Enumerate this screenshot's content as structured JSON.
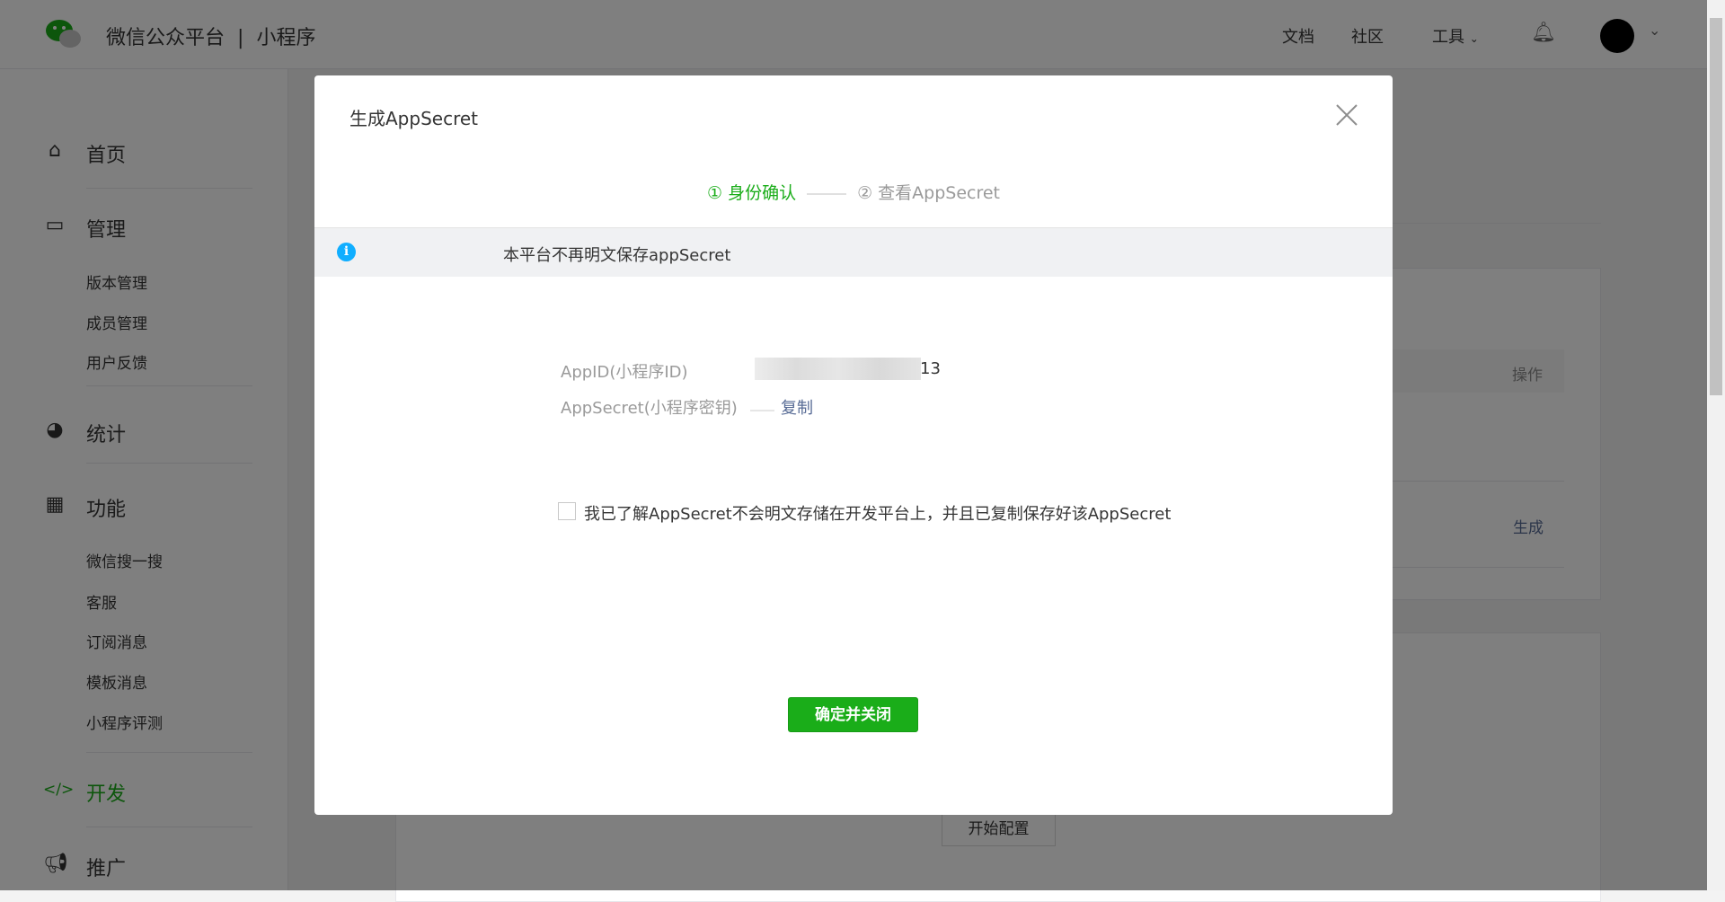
{
  "header": {
    "brand": "微信公众平台",
    "separator": "|",
    "product": "小程序",
    "nav": [
      "文档",
      "社区",
      "工具"
    ]
  },
  "sidebar": {
    "home": "首页",
    "manage": "管理",
    "manage_items": [
      "版本管理",
      "成员管理",
      "用户反馈"
    ],
    "stats": "统计",
    "features": "功能",
    "feature_items": [
      "微信搜一搜",
      "客服",
      "订阅消息",
      "模板消息",
      "小程序评测"
    ],
    "develop": "开发",
    "promote": "推广"
  },
  "background": {
    "col_action": "操作",
    "generate": "生成",
    "start_config": "开始配置"
  },
  "modal": {
    "title": "生成AppSecret",
    "step1": "① 身份确认",
    "step2": "② 查看AppSecret",
    "info": "本平台不再明文保存appSecret",
    "appid_label": "AppID(小程序ID)",
    "appid_value_suffix": "13",
    "secret_label": "AppSecret(小程序密钥)",
    "copy": "复制",
    "checkbox_text": "我已了解AppSecret不会明文存储在开发平台上，并且已复制保存好该AppSecret",
    "confirm": "确定并关闭"
  },
  "colors": {
    "accent": "#1aad19",
    "link": "#576b95",
    "info": "#10aeff"
  }
}
